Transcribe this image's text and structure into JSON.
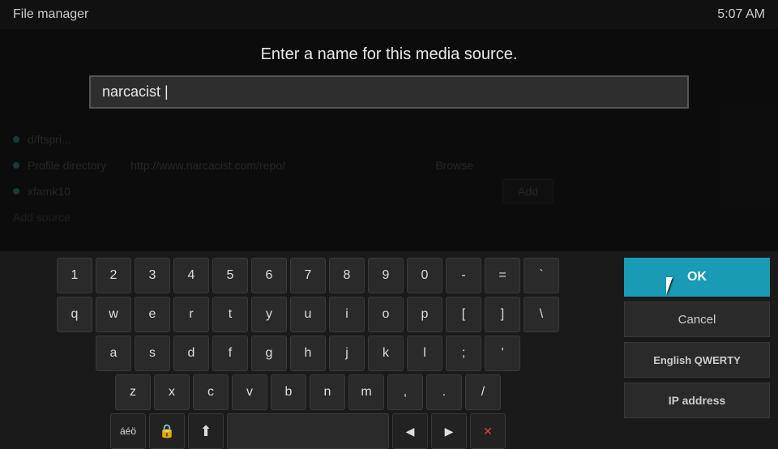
{
  "topbar": {
    "title": "File manager",
    "time": "5:07 AM"
  },
  "dialog": {
    "prompt": "Enter a name for this media source.",
    "input_value": "narcacist |"
  },
  "bg_list": [
    {
      "label": "d/ftspri...",
      "dot": true
    },
    {
      "label": "Profile directory",
      "url": "http://www.narcacist.com/repo/",
      "browse": "Browse"
    },
    {
      "label": "xfamk10",
      "dot": true
    },
    {
      "label": "Add source",
      "dot": false
    }
  ],
  "keyboard": {
    "rows": [
      [
        "1",
        "2",
        "3",
        "4",
        "5",
        "6",
        "7",
        "8",
        "9",
        "0",
        "-",
        "=",
        "`"
      ],
      [
        "q",
        "w",
        "e",
        "r",
        "t",
        "y",
        "u",
        "i",
        "o",
        "p",
        "[",
        "]",
        "\\"
      ],
      [
        "a",
        "s",
        "d",
        "f",
        "g",
        "h",
        "j",
        "k",
        "l",
        ";",
        "'"
      ],
      [
        "z",
        "x",
        "c",
        "v",
        "b",
        "n",
        "m",
        ",",
        ".",
        "/"
      ]
    ],
    "bottom_special": {
      "aeo": "áéö",
      "lock": "🔒",
      "shift": "⬆",
      "space": "",
      "left": "◀",
      "right": "▶",
      "backspace": "✕"
    }
  },
  "right_panel": {
    "ok_label": "OK",
    "cancel_label": "Cancel",
    "layout_label": "English QWERTY",
    "ip_label": "IP address"
  }
}
